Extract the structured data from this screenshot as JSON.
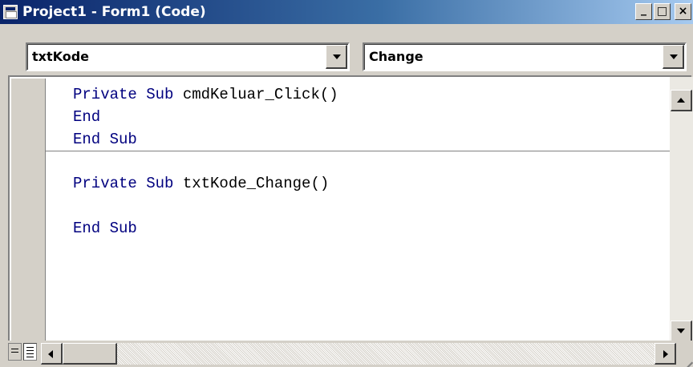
{
  "window": {
    "title": "Project1 - Form1 (Code)",
    "buttons": {
      "minimize": "_",
      "maximize": "□",
      "close": "×"
    }
  },
  "toolbar": {
    "object_combo": {
      "selected": "txtKode"
    },
    "procedure_combo": {
      "selected": "Change"
    }
  },
  "code": {
    "lines": [
      {
        "keyword": "Private Sub",
        "rest": " cmdKeluar_Click()"
      },
      {
        "keyword": "End",
        "rest": ""
      },
      {
        "keyword": "End Sub",
        "rest": ""
      },
      {
        "keyword": "Private Sub",
        "rest": " txtKode_Change()"
      },
      {
        "keyword": "",
        "rest": ""
      },
      {
        "keyword": "End Sub",
        "rest": ""
      }
    ]
  },
  "colors": {
    "keyword": "#00007f",
    "title_gradient_start": "#0a246a",
    "title_gradient_end": "#a6caf0",
    "chrome": "#d4d0c8"
  },
  "icons": {
    "app": "vb-form-icon",
    "scroll_up": "up-arrow-icon",
    "scroll_down": "down-arrow-icon",
    "scroll_left": "left-arrow-icon",
    "scroll_right": "right-arrow-icon",
    "procedure_view": "procedure-view-icon",
    "full_module_view": "full-module-view-icon"
  }
}
